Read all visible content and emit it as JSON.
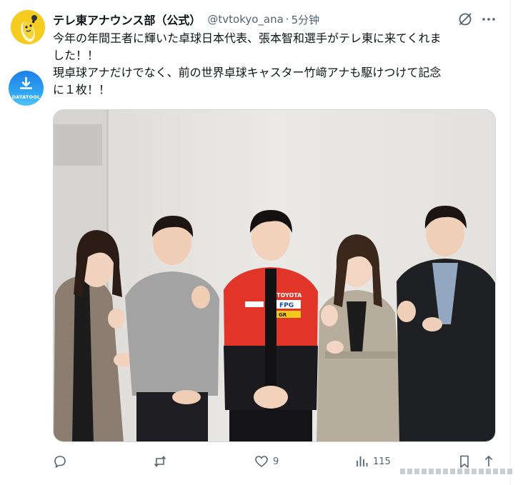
{
  "tweet": {
    "display_name": "テレ東アナウンス部（公式）",
    "handle": "@tvtokyo_ana",
    "separator": "·",
    "time": "5分钟",
    "text_lines": [
      "今年の年間王者に輝いた卓球日本代表、張本智和選手がテレ東に来てくれま",
      "した！！",
      "現卓球アナだけでなく、前の世界卓球キャスター竹﨑アナも駆けつけて記念",
      "に１枚！！"
    ]
  },
  "icons": {
    "avatar": "mascot-avatar",
    "download_badge": "download-icon",
    "grok": "grok-icon",
    "more": "more-icon",
    "reply": "reply-icon",
    "retweet": "retweet-icon",
    "like": "heart-icon",
    "views": "views-icon",
    "bookmark": "bookmark-icon",
    "share": "share-icon"
  },
  "badge": {
    "label": "DATATOOL"
  },
  "photo": {
    "jersey_texts": [
      "TOYOTA",
      "FPG",
      "GR"
    ]
  },
  "actions": {
    "reply_count": "",
    "retweet_count": "",
    "like_count": "9",
    "view_count": "115"
  },
  "colors": {
    "text": "#0f1419",
    "secondary": "#536471",
    "avatar_bg": "#f7cc21",
    "badge_blue": "#1e7fe6",
    "jersey_red": "#e2352a"
  }
}
